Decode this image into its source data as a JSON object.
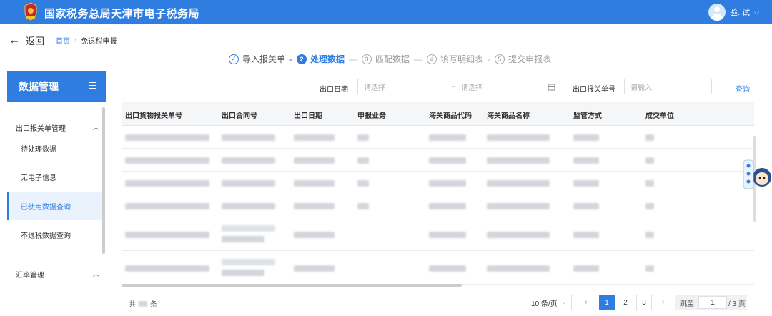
{
  "header": {
    "title": "国家税务总局天津市电子税务局",
    "user_name": "验..试"
  },
  "nav": {
    "back_label": "返回",
    "breadcrumb_home": "首页",
    "breadcrumb_sep": "›",
    "breadcrumb_current": "免退税申报"
  },
  "steps": [
    {
      "num": "✓",
      "label": "导入报关单",
      "state": "done"
    },
    {
      "num": "2",
      "label": "处理数据",
      "state": "active"
    },
    {
      "num": "3",
      "label": "匹配数据",
      "state": "pending"
    },
    {
      "num": "4",
      "label": "填写明细表",
      "state": "pending"
    },
    {
      "num": "5",
      "label": "提交申报表",
      "state": "pending"
    }
  ],
  "sidebar": {
    "title": "数据管理",
    "group1": "出口报关单管理",
    "items": [
      "待处理数据",
      "无电子信息",
      "已使用数据查询",
      "不退税数据查询"
    ],
    "group2": "汇率管理"
  },
  "filters": {
    "date_label": "出口日期",
    "date_start_placeholder": "请选择",
    "date_sep": "-",
    "date_end_placeholder": "请选择",
    "decl_label": "出口报关单号",
    "decl_placeholder": "请输入",
    "query_label": "查询"
  },
  "table": {
    "columns": [
      "出口货物报关单号",
      "出口合同号",
      "出口日期",
      "申报业务",
      "海关商品代码",
      "海关商品名称",
      "监管方式",
      "成交单位"
    ]
  },
  "pagination": {
    "total_prefix": "共",
    "total_suffix": "条",
    "page_size": "10 条/页",
    "prev": "‹",
    "pages": [
      "1",
      "2",
      "3"
    ],
    "next": "›",
    "jump_label": "跳至",
    "jump_value": "1",
    "total_pages": "/ 3 页"
  },
  "colors": {
    "primary": "#2f7de1",
    "header_bg": "#2f7de1",
    "sidebar_active_bg": "#eaf2fd"
  }
}
